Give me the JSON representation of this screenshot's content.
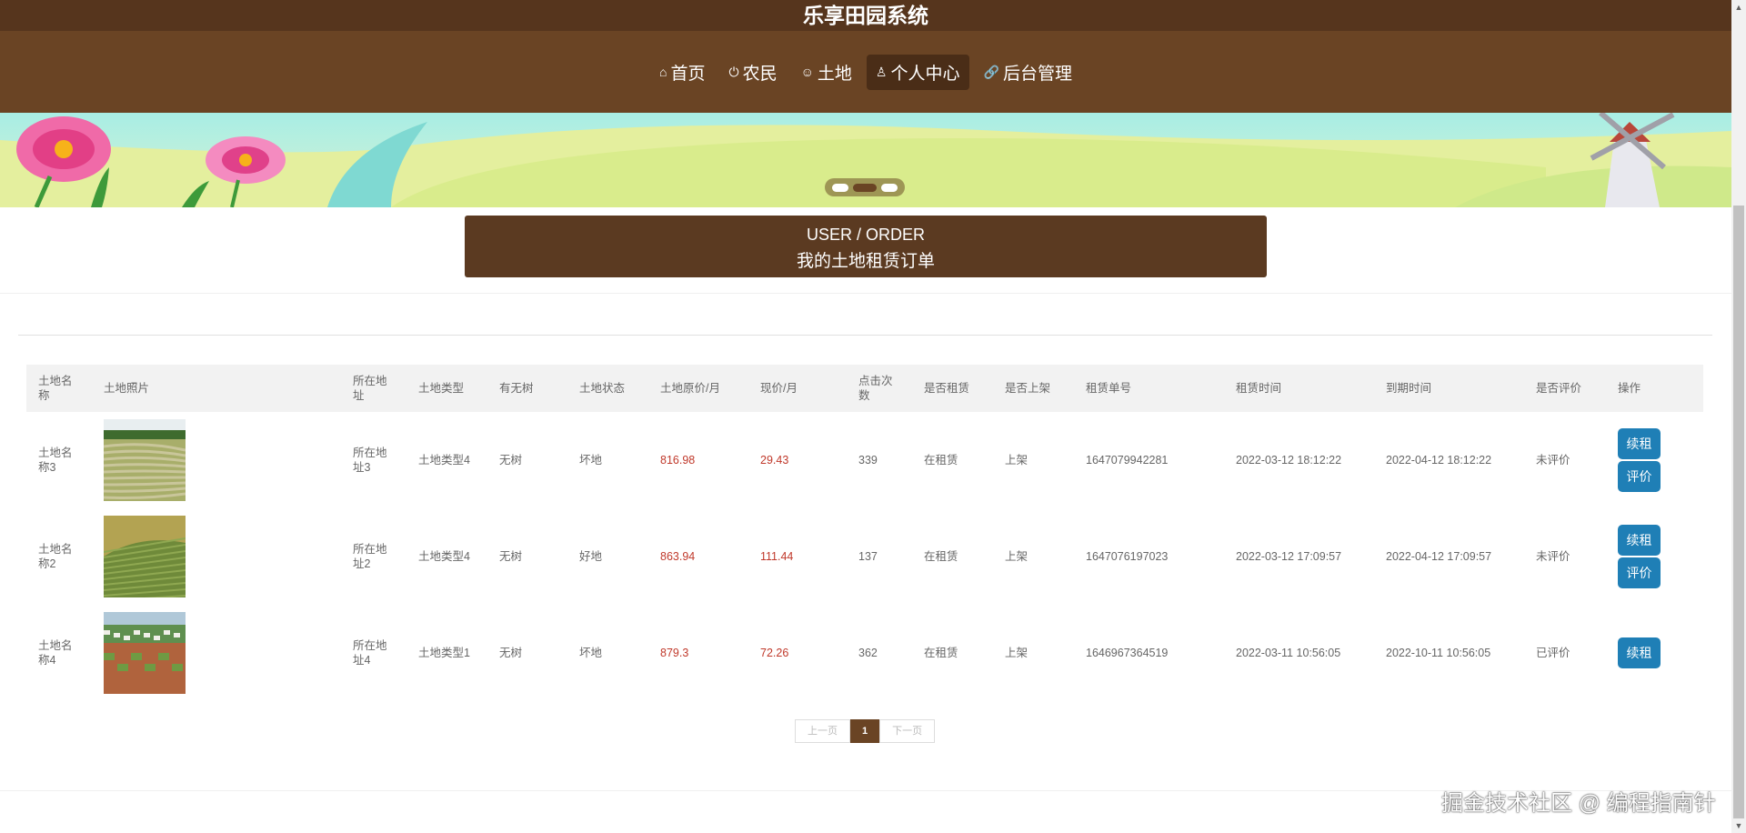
{
  "site": {
    "title": "乐享田园系统"
  },
  "nav": [
    {
      "icon": "home-icon",
      "glyph": "⌂",
      "label": "首页",
      "active": false
    },
    {
      "icon": "power-icon",
      "glyph": "⏻",
      "label": "农民",
      "active": false
    },
    {
      "icon": "smile-icon",
      "glyph": "☺",
      "label": "土地",
      "active": false
    },
    {
      "icon": "user-icon",
      "glyph": "♙",
      "label": "个人中心",
      "active": true
    },
    {
      "icon": "link-icon",
      "glyph": "🔗",
      "label": "后台管理",
      "active": false
    }
  ],
  "banner": {
    "slides": 3,
    "active_index": 1
  },
  "section": {
    "en": "USER / ORDER",
    "zh": "我的土地租赁订单"
  },
  "table": {
    "headers": [
      "土地名称",
      "土地照片",
      "所在地址",
      "土地类型",
      "有无树",
      "土地状态",
      "土地原价/月",
      "现价/月",
      "点击次数",
      "是否租赁",
      "是否上架",
      "租赁单号",
      "租赁时间",
      "到期时间",
      "是否评价",
      "操作"
    ],
    "rows": [
      {
        "name": "土地名称3",
        "photo": "field-furrows-photo",
        "address": "所在地址3",
        "type": "土地类型4",
        "tree": "无树",
        "status": "坏地",
        "orig_price": "816.98",
        "cur_price": "29.43",
        "clicks": "339",
        "rented": "在租赁",
        "listed": "上架",
        "order_no": "1647079942281",
        "rent_time": "2022-03-12 18:12:22",
        "expire_time": "2022-04-12 18:12:22",
        "reviewed": "未评价",
        "actions": [
          "续租",
          "评价"
        ]
      },
      {
        "name": "土地名称2",
        "photo": "green-field-photo",
        "address": "所在地址2",
        "type": "土地类型4",
        "tree": "无树",
        "status": "好地",
        "orig_price": "863.94",
        "cur_price": "111.44",
        "clicks": "137",
        "rented": "在租赁",
        "listed": "上架",
        "order_no": "1647076197023",
        "rent_time": "2022-03-12 17:09:57",
        "expire_time": "2022-04-12 17:09:57",
        "reviewed": "未评价",
        "actions": [
          "续租",
          "评价"
        ]
      },
      {
        "name": "土地名称4",
        "photo": "village-field-photo",
        "address": "所在地址4",
        "type": "土地类型1",
        "tree": "无树",
        "status": "坏地",
        "orig_price": "879.3",
        "cur_price": "72.26",
        "clicks": "362",
        "rented": "在租赁",
        "listed": "上架",
        "order_no": "1646967364519",
        "rent_time": "2022-03-11 10:56:05",
        "expire_time": "2022-10-11 10:56:05",
        "reviewed": "已评价",
        "actions": [
          "续租"
        ]
      }
    ]
  },
  "pagination": {
    "prev": "上一页",
    "current": "1",
    "next": "下一页"
  },
  "watermark": "掘金技术社区 @ 编程指南针",
  "colors": {
    "header": "#56351d",
    "nav": "#6a4424",
    "title_block": "#5b3a21",
    "button": "#1f7fb6",
    "price": "#c0392b"
  }
}
